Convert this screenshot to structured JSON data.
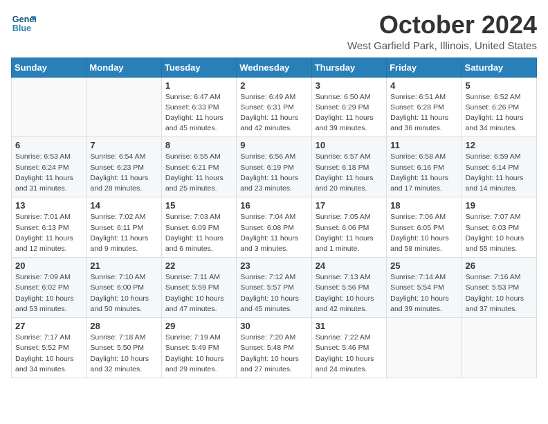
{
  "header": {
    "logo_line1": "General",
    "logo_line2": "Blue",
    "month_title": "October 2024",
    "location": "West Garfield Park, Illinois, United States"
  },
  "weekdays": [
    "Sunday",
    "Monday",
    "Tuesday",
    "Wednesday",
    "Thursday",
    "Friday",
    "Saturday"
  ],
  "weeks": [
    [
      {
        "day": "",
        "info": ""
      },
      {
        "day": "",
        "info": ""
      },
      {
        "day": "1",
        "info": "Sunrise: 6:47 AM\nSunset: 6:33 PM\nDaylight: 11 hours and 45 minutes."
      },
      {
        "day": "2",
        "info": "Sunrise: 6:49 AM\nSunset: 6:31 PM\nDaylight: 11 hours and 42 minutes."
      },
      {
        "day": "3",
        "info": "Sunrise: 6:50 AM\nSunset: 6:29 PM\nDaylight: 11 hours and 39 minutes."
      },
      {
        "day": "4",
        "info": "Sunrise: 6:51 AM\nSunset: 6:28 PM\nDaylight: 11 hours and 36 minutes."
      },
      {
        "day": "5",
        "info": "Sunrise: 6:52 AM\nSunset: 6:26 PM\nDaylight: 11 hours and 34 minutes."
      }
    ],
    [
      {
        "day": "6",
        "info": "Sunrise: 6:53 AM\nSunset: 6:24 PM\nDaylight: 11 hours and 31 minutes."
      },
      {
        "day": "7",
        "info": "Sunrise: 6:54 AM\nSunset: 6:23 PM\nDaylight: 11 hours and 28 minutes."
      },
      {
        "day": "8",
        "info": "Sunrise: 6:55 AM\nSunset: 6:21 PM\nDaylight: 11 hours and 25 minutes."
      },
      {
        "day": "9",
        "info": "Sunrise: 6:56 AM\nSunset: 6:19 PM\nDaylight: 11 hours and 23 minutes."
      },
      {
        "day": "10",
        "info": "Sunrise: 6:57 AM\nSunset: 6:18 PM\nDaylight: 11 hours and 20 minutes."
      },
      {
        "day": "11",
        "info": "Sunrise: 6:58 AM\nSunset: 6:16 PM\nDaylight: 11 hours and 17 minutes."
      },
      {
        "day": "12",
        "info": "Sunrise: 6:59 AM\nSunset: 6:14 PM\nDaylight: 11 hours and 14 minutes."
      }
    ],
    [
      {
        "day": "13",
        "info": "Sunrise: 7:01 AM\nSunset: 6:13 PM\nDaylight: 11 hours and 12 minutes."
      },
      {
        "day": "14",
        "info": "Sunrise: 7:02 AM\nSunset: 6:11 PM\nDaylight: 11 hours and 9 minutes."
      },
      {
        "day": "15",
        "info": "Sunrise: 7:03 AM\nSunset: 6:09 PM\nDaylight: 11 hours and 6 minutes."
      },
      {
        "day": "16",
        "info": "Sunrise: 7:04 AM\nSunset: 6:08 PM\nDaylight: 11 hours and 3 minutes."
      },
      {
        "day": "17",
        "info": "Sunrise: 7:05 AM\nSunset: 6:06 PM\nDaylight: 11 hours and 1 minute."
      },
      {
        "day": "18",
        "info": "Sunrise: 7:06 AM\nSunset: 6:05 PM\nDaylight: 10 hours and 58 minutes."
      },
      {
        "day": "19",
        "info": "Sunrise: 7:07 AM\nSunset: 6:03 PM\nDaylight: 10 hours and 55 minutes."
      }
    ],
    [
      {
        "day": "20",
        "info": "Sunrise: 7:09 AM\nSunset: 6:02 PM\nDaylight: 10 hours and 53 minutes."
      },
      {
        "day": "21",
        "info": "Sunrise: 7:10 AM\nSunset: 6:00 PM\nDaylight: 10 hours and 50 minutes."
      },
      {
        "day": "22",
        "info": "Sunrise: 7:11 AM\nSunset: 5:59 PM\nDaylight: 10 hours and 47 minutes."
      },
      {
        "day": "23",
        "info": "Sunrise: 7:12 AM\nSunset: 5:57 PM\nDaylight: 10 hours and 45 minutes."
      },
      {
        "day": "24",
        "info": "Sunrise: 7:13 AM\nSunset: 5:56 PM\nDaylight: 10 hours and 42 minutes."
      },
      {
        "day": "25",
        "info": "Sunrise: 7:14 AM\nSunset: 5:54 PM\nDaylight: 10 hours and 39 minutes."
      },
      {
        "day": "26",
        "info": "Sunrise: 7:16 AM\nSunset: 5:53 PM\nDaylight: 10 hours and 37 minutes."
      }
    ],
    [
      {
        "day": "27",
        "info": "Sunrise: 7:17 AM\nSunset: 5:52 PM\nDaylight: 10 hours and 34 minutes."
      },
      {
        "day": "28",
        "info": "Sunrise: 7:18 AM\nSunset: 5:50 PM\nDaylight: 10 hours and 32 minutes."
      },
      {
        "day": "29",
        "info": "Sunrise: 7:19 AM\nSunset: 5:49 PM\nDaylight: 10 hours and 29 minutes."
      },
      {
        "day": "30",
        "info": "Sunrise: 7:20 AM\nSunset: 5:48 PM\nDaylight: 10 hours and 27 minutes."
      },
      {
        "day": "31",
        "info": "Sunrise: 7:22 AM\nSunset: 5:46 PM\nDaylight: 10 hours and 24 minutes."
      },
      {
        "day": "",
        "info": ""
      },
      {
        "day": "",
        "info": ""
      }
    ]
  ]
}
